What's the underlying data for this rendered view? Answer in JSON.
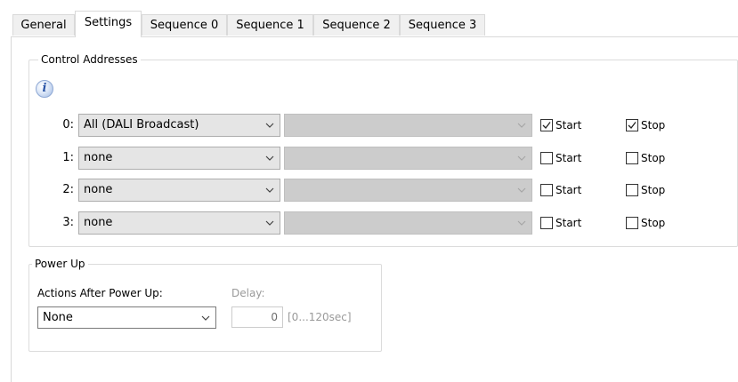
{
  "tabs": [
    {
      "label": "General",
      "active": false
    },
    {
      "label": "Settings",
      "active": true
    },
    {
      "label": "Sequence 0",
      "active": false
    },
    {
      "label": "Sequence 1",
      "active": false
    },
    {
      "label": "Sequence 2",
      "active": false
    },
    {
      "label": "Sequence 3",
      "active": false
    }
  ],
  "control_addresses": {
    "title": "Control Addresses",
    "info_icon_glyph": "i",
    "rows": [
      {
        "index": "0:",
        "address": "All (DALI Broadcast)",
        "secondary": "",
        "start_label": "Start",
        "start_checked": true,
        "stop_label": "Stop",
        "stop_checked": true
      },
      {
        "index": "1:",
        "address": "none",
        "secondary": "",
        "start_label": "Start",
        "start_checked": false,
        "stop_label": "Stop",
        "stop_checked": false
      },
      {
        "index": "2:",
        "address": "none",
        "secondary": "",
        "start_label": "Start",
        "start_checked": false,
        "stop_label": "Stop",
        "stop_checked": false
      },
      {
        "index": "3:",
        "address": "none",
        "secondary": "",
        "start_label": "Start",
        "start_checked": false,
        "stop_label": "Stop",
        "stop_checked": false
      }
    ]
  },
  "power_up": {
    "title": "Power Up",
    "actions_label": "Actions After Power Up:",
    "actions_value": "None",
    "delay_label": "Delay:",
    "delay_value": "0",
    "delay_range": "[0...120sec]"
  },
  "colors": {
    "tab_border": "#d9d9d9",
    "combo_bg": "#e5e5e5",
    "combo_disabled_bg": "#cccccc",
    "disabled_text": "#9a9a9a"
  }
}
